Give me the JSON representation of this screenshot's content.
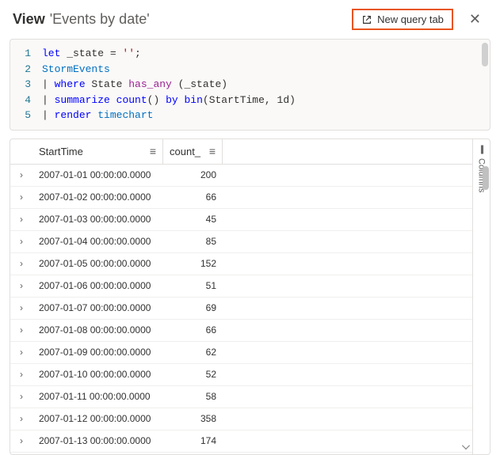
{
  "header": {
    "title": "View",
    "subtitle": "'Events by date'",
    "newQueryLabel": "New query tab"
  },
  "code": {
    "lines": [
      {
        "n": "1",
        "html": "<span class='kw'>let</span> _state = <span class='str'>''</span>;"
      },
      {
        "n": "2",
        "html": "<span class='tbl'>StormEvents</span>"
      },
      {
        "n": "3",
        "html": "| <span class='kw'>where</span> State <span class='op'>has_any</span> (_state)"
      },
      {
        "n": "4",
        "html": "| <span class='kw'>summarize</span> <span class='fn'>count</span>() <span class='kw'>by</span> <span class='fn'>bin</span>(StartTime, <span class='param'>1d</span>)"
      },
      {
        "n": "5",
        "html": "| <span class='kw'>render</span> <span class='tbl'>timechart</span>"
      }
    ]
  },
  "grid": {
    "columns": {
      "start": "StartTime",
      "count": "count_"
    },
    "columnsTabLabel": "Columns",
    "rows": [
      {
        "start": "2007-01-01 00:00:00.0000",
        "count": "200"
      },
      {
        "start": "2007-01-02 00:00:00.0000",
        "count": "66"
      },
      {
        "start": "2007-01-03 00:00:00.0000",
        "count": "45"
      },
      {
        "start": "2007-01-04 00:00:00.0000",
        "count": "85"
      },
      {
        "start": "2007-01-05 00:00:00.0000",
        "count": "152"
      },
      {
        "start": "2007-01-06 00:00:00.0000",
        "count": "51"
      },
      {
        "start": "2007-01-07 00:00:00.0000",
        "count": "69"
      },
      {
        "start": "2007-01-08 00:00:00.0000",
        "count": "66"
      },
      {
        "start": "2007-01-09 00:00:00.0000",
        "count": "62"
      },
      {
        "start": "2007-01-10 00:00:00.0000",
        "count": "52"
      },
      {
        "start": "2007-01-11 00:00:00.0000",
        "count": "58"
      },
      {
        "start": "2007-01-12 00:00:00.0000",
        "count": "358"
      },
      {
        "start": "2007-01-13 00:00:00.0000",
        "count": "174"
      }
    ]
  }
}
